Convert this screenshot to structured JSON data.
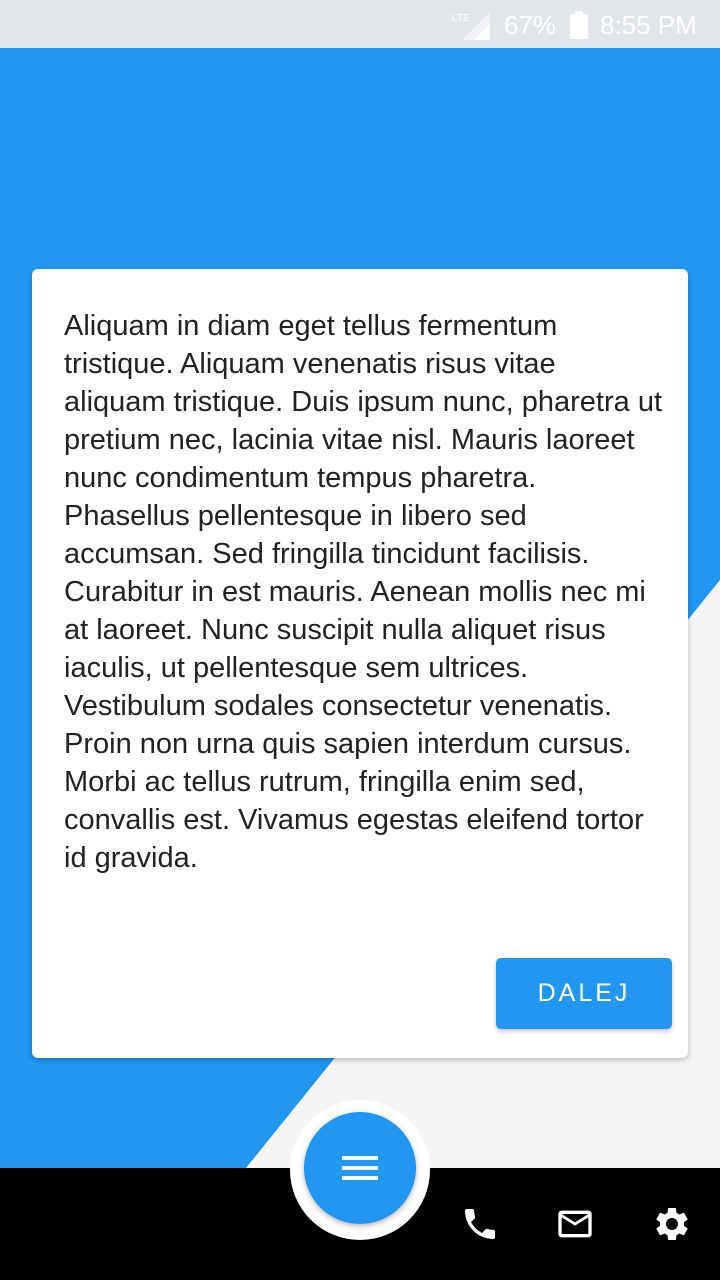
{
  "status_bar": {
    "network": "LTE",
    "battery": "67%",
    "time": "8:55 PM"
  },
  "card": {
    "text": "Aliquam in diam eget tellus fermentum tristique. Aliquam venenatis risus vitae aliquam tristique. Duis ipsum nunc, pharetra ut pretium nec, lacinia vitae nisl. Mauris laoreet nunc condimentum tempus pharetra. Phasellus pellentesque in libero sed accumsan. Sed fringilla tincidunt facilisis. Curabitur in est mauris. Aenean mollis nec mi at laoreet. Nunc suscipit nulla aliquet risus iaculis, ut pellentesque sem ultrices. Vestibulum sodales consectetur venenatis. Proin non urna quis sapien interdum cursus. Morbi ac tellus rutrum, fringilla enim sed, convallis est. Vivamus egestas eleifend tortor id gravida.",
    "button_label": "DALEJ"
  },
  "bottom_nav": {
    "fab_icon": "menu-icon",
    "items": [
      {
        "icon": "phone-icon"
      },
      {
        "icon": "mail-icon"
      },
      {
        "icon": "gear-icon"
      }
    ]
  },
  "colors": {
    "accent": "#2196f3",
    "background_light": "#f5f5f5",
    "bottom_bar": "#000000"
  }
}
